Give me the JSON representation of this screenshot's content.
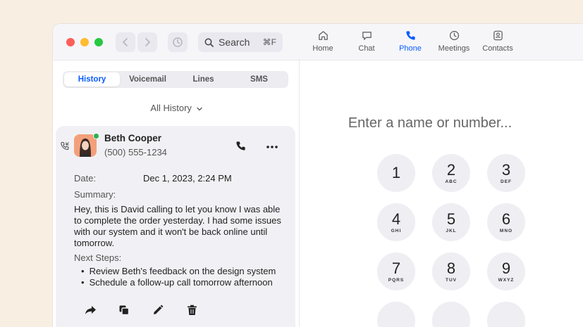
{
  "search": {
    "label": "Search",
    "shortcut": "⌘F"
  },
  "tabs": [
    {
      "label": "Home",
      "icon": "home-icon"
    },
    {
      "label": "Chat",
      "icon": "chat-icon"
    },
    {
      "label": "Phone",
      "icon": "phone-icon",
      "active": true
    },
    {
      "label": "Meetings",
      "icon": "clock-icon"
    },
    {
      "label": "Contacts",
      "icon": "contacts-icon"
    }
  ],
  "segments": [
    {
      "label": "History",
      "active": true
    },
    {
      "label": "Voicemail"
    },
    {
      "label": "Lines"
    },
    {
      "label": "SMS"
    }
  ],
  "filter": {
    "label": "All History"
  },
  "call": {
    "name": "Beth Cooper",
    "number": "(500) 555-1234",
    "date_label": "Date:",
    "date_value": "Dec 1, 2023, 2:24 PM",
    "summary_label": "Summary:",
    "summary": "Hey, this is David calling to let you know I was able to complete the order yesterday. I had some issues with our system and it won't be back online until tomorrow.",
    "next_steps_label": "Next Steps:",
    "next_steps": [
      "Review Beth's feedback on the design system",
      "Schedule a follow-up call tomorrow afternoon"
    ]
  },
  "dialpad": {
    "placeholder": "Enter a name or number...",
    "keys": [
      {
        "digit": "1",
        "letters": ""
      },
      {
        "digit": "2",
        "letters": "ABC"
      },
      {
        "digit": "3",
        "letters": "DEF"
      },
      {
        "digit": "4",
        "letters": "GHI"
      },
      {
        "digit": "5",
        "letters": "JKL"
      },
      {
        "digit": "6",
        "letters": "MNO"
      },
      {
        "digit": "7",
        "letters": "PQRS"
      },
      {
        "digit": "8",
        "letters": "TUV"
      },
      {
        "digit": "9",
        "letters": "WXYZ"
      }
    ]
  },
  "colors": {
    "accent": "#0b5cff",
    "presence": "#2bb24c",
    "background": "#f8efe2"
  }
}
